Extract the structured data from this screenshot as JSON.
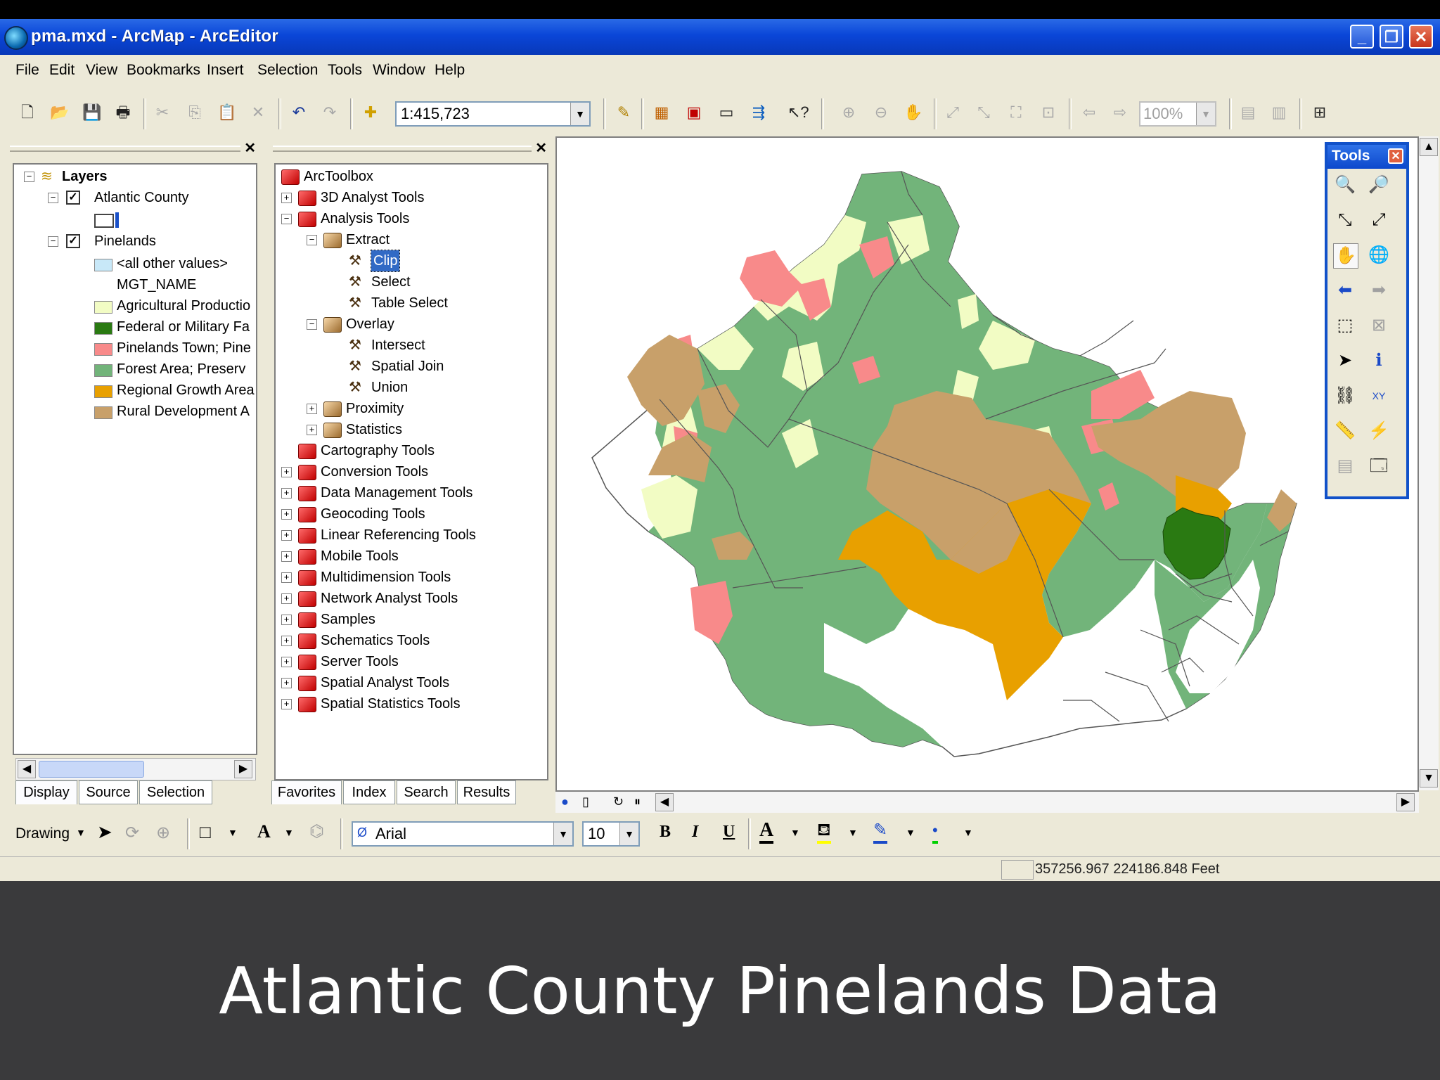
{
  "window": {
    "title": "pma.mxd - ArcMap - ArcEditor",
    "minimize": "_",
    "restore": "❐",
    "close": "✕"
  },
  "menu": [
    "File",
    "Edit",
    "View",
    "Bookmarks",
    "Insert",
    "Selection",
    "Tools",
    "Window",
    "Help"
  ],
  "toolbar": {
    "scale": "1:415,723",
    "zoom": "100%"
  },
  "toc": {
    "root": "Layers",
    "layers": [
      {
        "name": "Atlantic County",
        "checked": true
      },
      {
        "name": "Pinelands",
        "checked": true
      }
    ],
    "legend_all_other": "<all other values>",
    "legend_field": "MGT_NAME",
    "legend_items": [
      {
        "label": "Agricultural Productio",
        "color": "#f2fcc4"
      },
      {
        "label": "Federal or Military Fa",
        "color": "#2a7a12"
      },
      {
        "label": "Pinelands Town; Pine",
        "color": "#f88a8a"
      },
      {
        "label": "Forest Area; Preserv",
        "color": "#72b47a"
      },
      {
        "label": "Regional Growth Area",
        "color": "#e8a000"
      },
      {
        "label": "Rural Development A",
        "color": "#c8a06a"
      }
    ],
    "tabs": [
      "Display",
      "Source",
      "Selection"
    ]
  },
  "toolbox": {
    "root": "ArcToolbox",
    "items": [
      "3D Analyst Tools",
      "Analysis Tools",
      "Extract",
      "Clip",
      "Select",
      "Table Select",
      "Overlay",
      "Intersect",
      "Spatial Join",
      "Union",
      "Proximity",
      "Statistics",
      "Cartography Tools",
      "Conversion Tools",
      "Data Management Tools",
      "Geocoding Tools",
      "Linear Referencing Tools",
      "Mobile Tools",
      "Multidimension Tools",
      "Network Analyst Tools",
      "Samples",
      "Schematics Tools",
      "Server Tools",
      "Spatial Analyst Tools",
      "Spatial Statistics Tools"
    ],
    "tabs": [
      "Favorites",
      "Index",
      "Search",
      "Results"
    ]
  },
  "tools_window": {
    "title": "Tools"
  },
  "drawing": {
    "label": "Drawing",
    "font": "Arial",
    "size": "10",
    "bold": "B",
    "italic": "I",
    "underline": "U",
    "text_a": "A"
  },
  "status": {
    "coords": "357256.967  224186.848 Feet"
  },
  "caption": "Atlantic County Pinelands Data",
  "colors": {
    "forest": "#72b47a",
    "agri": "#f2fcc4",
    "federal": "#2a7a12",
    "town": "#f88a8a",
    "growth": "#e8a000",
    "rural": "#c8a06a"
  }
}
